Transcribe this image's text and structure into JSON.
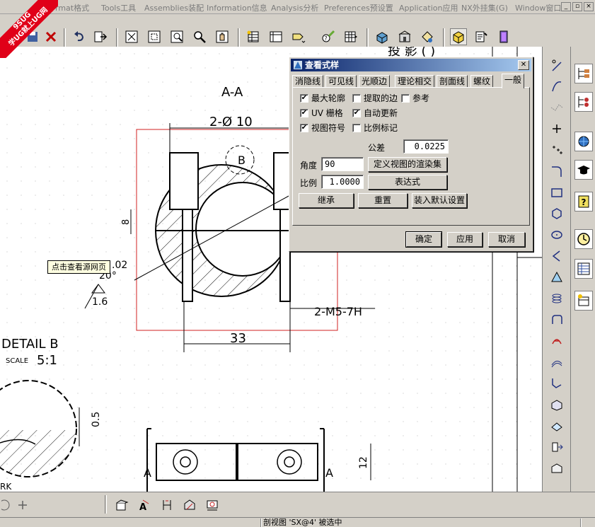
{
  "watermark": {
    "line1": "9SUG",
    "line2": "学UG就上UG网"
  },
  "menubar": {
    "items": [
      "rmat格式",
      "Tools工具",
      "Assemblies装配",
      "Information信息",
      "Analysis分析",
      "Preferences预设置",
      "Application应用",
      "NX外挂集(G)",
      "Window窗口"
    ],
    "window_controls": [
      "_",
      "▫",
      "×"
    ]
  },
  "tooltip": "点击查看源网页",
  "drawing": {
    "section_label": "A-A",
    "dim_bore": "2-Ø 10",
    "detail_marker": "B",
    "dim_height": "8",
    "tolerance_label": ".02",
    "angle_label": "20°",
    "roughness": "1.6",
    "dim_thread": "2-M5-7H",
    "dim_width": "33",
    "detail_title": "DETAIL B",
    "scale_word": "SCALE",
    "scale_value": "5:1",
    "dim_small": "0.5",
    "view_marker_left": "A",
    "view_marker_right": "A",
    "dim_12": "12",
    "partial_text": "RK",
    "top_partial": "投 影 ( )"
  },
  "dialog": {
    "title": "查看式样",
    "close": "✕",
    "tabs": [
      "消隐线",
      "可见线",
      "光顺边",
      "理论相交",
      "剖面线",
      "螺纹",
      "一般"
    ],
    "active_tab": "一般",
    "checkboxes": [
      {
        "label": "最大轮廓",
        "checked": true
      },
      {
        "label": "提取的边",
        "checked": false
      },
      {
        "label": "参考",
        "checked": false
      },
      {
        "label": "UV 栅格",
        "checked": true
      },
      {
        "label": "自动更新",
        "checked": true
      },
      {
        "label": "视图符号",
        "checked": true
      },
      {
        "label": "比例标记",
        "checked": false
      }
    ],
    "tolerance_label": "公差",
    "tolerance_value": "0.0225",
    "angle_label": "角度",
    "angle_value": "90",
    "render_button": "定义视图的渲染集",
    "scale_label": "比例",
    "scale_value": "1.0000",
    "expression_button": "表达式",
    "inherit_button": "继承",
    "reset_button": "重置",
    "load_default_button": "装入默认设置",
    "ok_button": "确定",
    "apply_button": "应用",
    "cancel_button": "取消"
  },
  "status": {
    "message": "剖视图 'SX@4' 被选中"
  }
}
